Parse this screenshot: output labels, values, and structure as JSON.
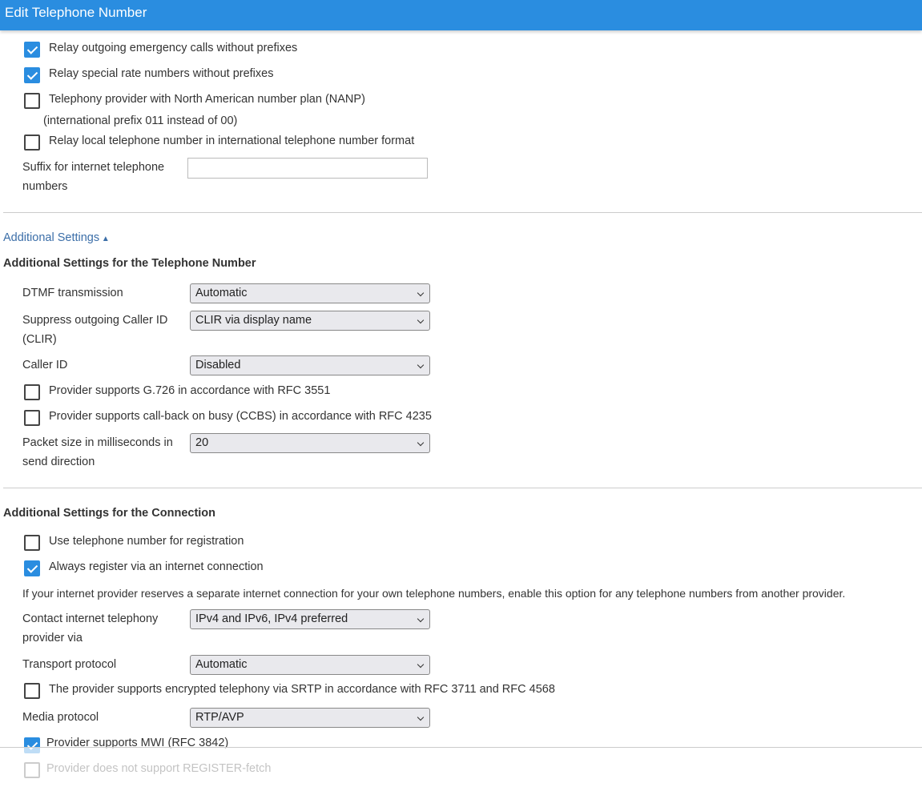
{
  "header": {
    "title": "Edit Telephone Number"
  },
  "top": {
    "relay_emergency": {
      "label": "Relay outgoing emergency calls without prefixes",
      "checked": true
    },
    "relay_special": {
      "label": "Relay special rate numbers without prefixes",
      "checked": true
    },
    "nanp": {
      "label": "Telephony provider with North American number plan (NANP)",
      "note": "(international prefix 011 instead of 00)",
      "checked": false
    },
    "relay_local": {
      "label": "Relay local telephone number in international telephone number format",
      "checked": false
    },
    "suffix": {
      "label1": "Suffix for internet telephone",
      "label2": "numbers",
      "value": ""
    }
  },
  "additional": {
    "toggle_label": "Additional Settings",
    "toggle_icon": "triangle-up",
    "number_heading": "Additional Settings for the Telephone Number",
    "dtmf": {
      "label": "DTMF transmission",
      "value": "Automatic"
    },
    "clir": {
      "label1": "Suppress outgoing Caller ID",
      "label2": "(CLIR)",
      "value": "CLIR via display name"
    },
    "caller_id": {
      "label": "Caller ID",
      "value": "Disabled"
    },
    "g726": {
      "label": "Provider supports G.726 in accordance with RFC 3551",
      "checked": false
    },
    "ccbs": {
      "label": "Provider supports call-back on busy (CCBS) in accordance with RFC 4235",
      "checked": false
    },
    "packet": {
      "label1": "Packet size in milliseconds in",
      "label2": "send direction",
      "value": "20"
    },
    "connection_heading": "Additional Settings for the Connection",
    "use_number": {
      "label": "Use telephone number for registration",
      "checked": false
    },
    "always_register": {
      "label": "Always register via an internet connection",
      "checked": true
    },
    "info": "If your internet provider reserves a separate internet connection for your own telephone numbers, enable this option for any telephone numbers from another provider.",
    "contact": {
      "label1": "Contact internet telephony",
      "label2": "provider via",
      "value": "IPv4 and IPv6, IPv4 preferred"
    },
    "transport": {
      "label": "Transport protocol",
      "value": "Automatic"
    },
    "srtp": {
      "label": "The provider supports encrypted telephony via SRTP in accordance with RFC 3711 and RFC 4568",
      "checked": false
    },
    "media": {
      "label": "Media protocol",
      "value": "RTP/AVP"
    },
    "mwi": {
      "label": "Provider supports MWI (RFC 3842)",
      "checked": true
    },
    "register_fetch": {
      "label": "Provider does not support REGISTER-fetch",
      "checked": false
    }
  }
}
